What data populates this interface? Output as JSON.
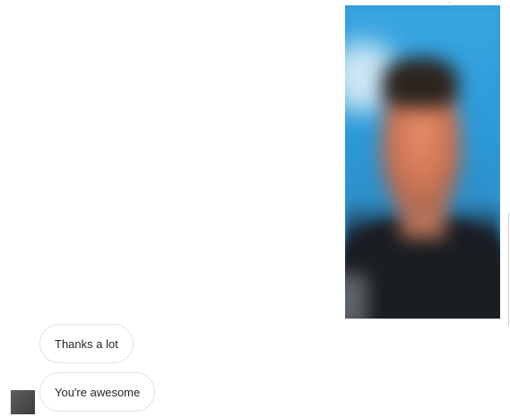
{
  "conversation": {
    "sent_photo": {
      "icon": "blurred-portrait-photo"
    },
    "received_messages": [
      {
        "text": "Thanks a lot"
      },
      {
        "text": "You're awesome"
      }
    ],
    "sender_avatar": {
      "icon": "avatar-image"
    }
  },
  "colors": {
    "bubble_border": "#e3e3e3",
    "message_text": "#262626",
    "background": "#ffffff"
  }
}
